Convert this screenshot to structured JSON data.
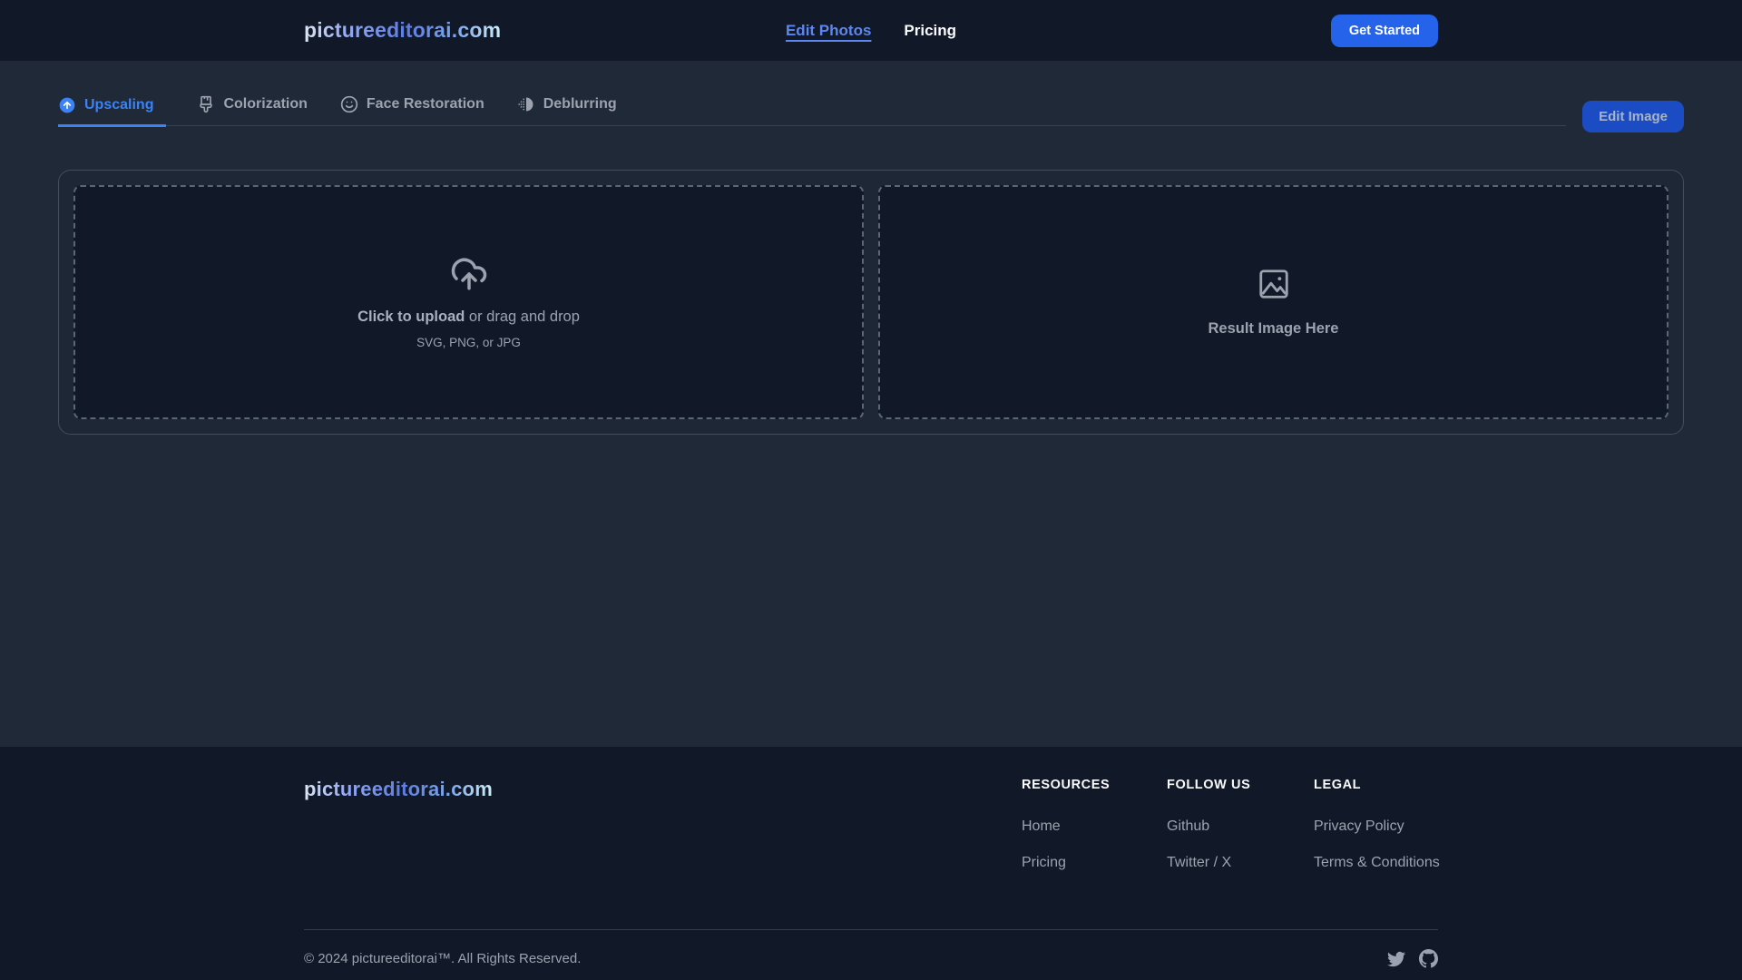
{
  "brand": {
    "name": "pictureeditorai.com"
  },
  "header": {
    "nav": [
      {
        "label": "Edit Photos",
        "active": true
      },
      {
        "label": "Pricing",
        "active": false
      }
    ],
    "cta_label": "Get Started"
  },
  "tabs": [
    {
      "label": "Upscaling",
      "icon": "circle-arrow-up-icon",
      "active": true
    },
    {
      "label": "Colorization",
      "icon": "paintbrush-icon",
      "active": false
    },
    {
      "label": "Face Restoration",
      "icon": "smile-icon",
      "active": false
    },
    {
      "label": "Deblurring",
      "icon": "blur-icon",
      "active": false
    }
  ],
  "edit_image_label": "Edit Image",
  "upload": {
    "click_strong": "Click to upload",
    "drag_rest": " or drag and drop",
    "formats": "SVG, PNG, or JPG",
    "icon": "cloud-upload-icon"
  },
  "result": {
    "label": "Result Image Here",
    "icon": "image-icon"
  },
  "footer": {
    "columns": [
      {
        "title": "RESOURCES",
        "links": [
          "Home",
          "Pricing"
        ]
      },
      {
        "title": "FOLLOW US",
        "links": [
          "Github",
          "Twitter / X"
        ]
      },
      {
        "title": "LEGAL",
        "links": [
          "Privacy Policy",
          "Terms & Conditions"
        ]
      }
    ],
    "copyright": "© 2024 pictureeditorai™. All Rights Reserved.",
    "social_icons": [
      "twitter-icon",
      "github-icon"
    ]
  },
  "colors": {
    "accent_blue": "#3b82f6",
    "cta_blue": "#2563eb",
    "edit_button_blue": "#1c4cc4",
    "header_footer_bg": "#111827",
    "main_bg": "#1f2937",
    "dropzone_bg": "#111827",
    "muted_text": "#9ca3af"
  }
}
